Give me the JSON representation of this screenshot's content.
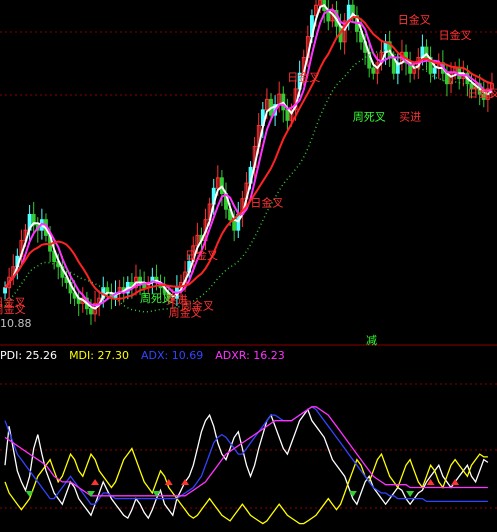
{
  "colors": {
    "background": "#000000",
    "up": "#54ffff",
    "down": "#33cc33",
    "bull": "#ff3333",
    "white_line": "#ffffff",
    "magenta_line": "#ff33ff",
    "red_line": "#ff2222",
    "dotted_line": "#33cc33",
    "grid": "#8b0000",
    "pdi": "#ffffff",
    "mdi": "#ffff00",
    "adx": "#3344ff",
    "adxr": "#ff33ff"
  },
  "price_label": "10.88",
  "badge": "减",
  "indicator_legend": [
    {
      "name": "PDI",
      "value": "25.26",
      "color": "#ffffff"
    },
    {
      "name": "MDI",
      "value": "27.30",
      "color": "#ffff00"
    },
    {
      "name": "ADX",
      "value": "10.69",
      "color": "#3344ff"
    },
    {
      "name": "ADXR",
      "value": "16.23",
      "color": "#ff33ff"
    }
  ],
  "signals": [
    {
      "text": "日金叉",
      "x_idx": 1,
      "y": 11.15,
      "color": "#ff3333"
    },
    {
      "text": "周金叉",
      "x_idx": 1,
      "y": 11.02,
      "color": "#ff3333"
    },
    {
      "text": "日金叉",
      "x_idx": 48,
      "y": 12.05,
      "color": "#ff3333"
    },
    {
      "text": "周金叉",
      "x_idx": 44,
      "y": 10.95,
      "color": "#ff3333"
    },
    {
      "text": "周死叉",
      "x_idx": 37,
      "y": 11.23,
      "color": "#33ff33"
    },
    {
      "text": "买进",
      "x_idx": 42,
      "y": 11.2,
      "color": "#ff3333"
    },
    {
      "text": "周金叉",
      "x_idx": 47,
      "y": 11.08,
      "color": "#ff3333"
    },
    {
      "text": "日金叉",
      "x_idx": 64,
      "y": 13.05,
      "color": "#ff3333"
    },
    {
      "text": "日金叉",
      "x_idx": 73,
      "y": 15.45,
      "color": "#ff3333"
    },
    {
      "text": "周死叉",
      "x_idx": 89,
      "y": 14.7,
      "color": "#33ff33"
    },
    {
      "text": "买进",
      "x_idx": 99,
      "y": 14.7,
      "color": "#ff3333"
    },
    {
      "text": "日金叉",
      "x_idx": 100,
      "y": 16.55,
      "color": "#ff3333"
    },
    {
      "text": "日金叉",
      "x_idx": 110,
      "y": 16.25,
      "color": "#ff3333"
    },
    {
      "text": "日金叉",
      "x_idx": 117,
      "y": 15.15,
      "color": "#ff3333"
    }
  ],
  "chart_data": [
    {
      "type": "candlestick",
      "title": "",
      "ylim": [
        10.5,
        17.0
      ],
      "series": [
        {
          "name": "close",
          "values": [
            11.5,
            11.7,
            11.9,
            12.1,
            12.4,
            12.6,
            12.9,
            12.7,
            12.6,
            12.8,
            12.5,
            12.2,
            12.0,
            11.9,
            11.7,
            11.6,
            11.4,
            11.3,
            11.2,
            11.3,
            11.1,
            11.0,
            11.2,
            11.3,
            11.5,
            11.4,
            11.3,
            11.4,
            11.5,
            11.4,
            11.6,
            11.5,
            11.7,
            11.6,
            11.5,
            11.6,
            11.7,
            11.6,
            11.5,
            11.4,
            11.3,
            11.3,
            11.5,
            11.6,
            11.8,
            12.0,
            12.3,
            12.5,
            12.4,
            12.8,
            13.1,
            13.4,
            13.6,
            13.3,
            13.0,
            12.8,
            12.6,
            12.9,
            13.2,
            13.5,
            13.8,
            14.2,
            14.6,
            14.9,
            15.1,
            14.8,
            15.0,
            15.2,
            14.9,
            14.7,
            14.9,
            15.3,
            15.6,
            15.9,
            16.3,
            16.7,
            16.9,
            17.0,
            16.8,
            16.6,
            16.8,
            16.5,
            16.2,
            16.6,
            16.9,
            16.7,
            16.4,
            16.2,
            16.0,
            15.7,
            15.6,
            15.8,
            16.0,
            16.2,
            15.9,
            15.6,
            15.8,
            16.0,
            15.8,
            15.6,
            15.7,
            15.9,
            16.1,
            15.9,
            15.6,
            15.7,
            15.8,
            15.6,
            15.4,
            15.6,
            15.7,
            15.5,
            15.6,
            15.4,
            15.3,
            15.4,
            15.2,
            15.1,
            15.3,
            15.4
          ]
        }
      ]
    },
    {
      "type": "line",
      "title": "",
      "ylim": [
        0,
        60
      ],
      "series": [
        {
          "name": "PDI",
          "values": [
            24,
            38,
            30,
            22,
            18,
            15,
            20,
            30,
            35,
            28,
            22,
            18,
            14,
            12,
            10,
            14,
            18,
            16,
            12,
            10,
            8,
            6,
            10,
            14,
            18,
            15,
            12,
            10,
            8,
            6,
            5,
            8,
            12,
            10,
            7,
            5,
            8,
            12,
            15,
            10,
            8,
            6,
            12,
            15,
            18,
            20,
            24,
            30,
            36,
            40,
            42,
            38,
            32,
            28,
            26,
            30,
            34,
            36,
            30,
            24,
            20,
            24,
            30,
            35,
            40,
            42,
            38,
            34,
            30,
            28,
            32,
            36,
            40,
            42,
            44,
            40,
            38,
            36,
            34,
            30,
            26,
            24,
            22,
            20,
            16,
            12,
            10,
            14,
            18,
            20,
            16,
            14,
            12,
            10,
            12,
            14,
            16,
            15,
            12,
            10,
            12,
            14,
            15,
            18,
            20,
            22,
            24,
            20,
            18,
            16,
            18,
            20,
            22,
            24,
            20,
            18,
            22,
            26,
            25
          ]
        },
        {
          "name": "MDI",
          "values": [
            18,
            14,
            12,
            10,
            8,
            10,
            12,
            16,
            20,
            22,
            24,
            26,
            22,
            18,
            20,
            24,
            28,
            26,
            22,
            20,
            24,
            28,
            26,
            22,
            20,
            18,
            16,
            18,
            22,
            26,
            28,
            30,
            26,
            22,
            18,
            16,
            14,
            18,
            22,
            20,
            16,
            14,
            12,
            10,
            8,
            6,
            5,
            6,
            8,
            10,
            12,
            10,
            8,
            6,
            5,
            4,
            6,
            8,
            10,
            8,
            6,
            5,
            4,
            3,
            4,
            6,
            8,
            10,
            8,
            6,
            5,
            4,
            3,
            3,
            4,
            5,
            6,
            8,
            10,
            12,
            10,
            8,
            10,
            14,
            18,
            22,
            26,
            24,
            20,
            18,
            22,
            26,
            28,
            24,
            20,
            18,
            16,
            20,
            24,
            26,
            22,
            18,
            16,
            20,
            24,
            22,
            18,
            16,
            20,
            24,
            26,
            24,
            22,
            20,
            24,
            26,
            28,
            27,
            27
          ]
        },
        {
          "name": "ADX",
          "values": [
            40,
            36,
            32,
            28,
            26,
            24,
            22,
            20,
            18,
            16,
            14,
            12,
            12,
            14,
            16,
            18,
            20,
            18,
            16,
            14,
            12,
            10,
            10,
            12,
            14,
            14,
            13,
            12,
            12,
            12,
            12,
            12,
            12,
            12,
            12,
            12,
            12,
            12,
            12,
            12,
            12,
            12,
            12,
            13,
            14,
            15,
            16,
            18,
            20,
            24,
            28,
            32,
            34,
            35,
            34,
            32,
            30,
            28,
            28,
            30,
            32,
            34,
            36,
            38,
            40,
            42,
            42,
            41,
            40,
            40,
            40,
            41,
            42,
            43,
            44,
            45,
            44,
            42,
            40,
            38,
            36,
            34,
            32,
            30,
            28,
            26,
            24,
            22,
            20,
            18,
            16,
            15,
            14,
            14,
            13,
            13,
            12,
            12,
            12,
            12,
            12,
            12,
            12,
            11,
            11,
            11,
            11,
            11,
            11,
            11,
            11,
            11,
            11,
            11,
            11,
            11,
            11,
            11,
            11
          ]
        },
        {
          "name": "ADXR",
          "values": [
            34,
            33,
            32,
            31,
            30,
            29,
            28,
            27,
            26,
            25,
            24,
            22,
            20,
            19,
            18,
            18,
            18,
            17,
            16,
            15,
            14,
            13,
            13,
            13,
            13,
            13,
            13,
            13,
            13,
            13,
            13,
            13,
            13,
            13,
            13,
            13,
            13,
            13,
            13,
            13,
            13,
            13,
            13,
            13,
            13,
            14,
            15,
            16,
            17,
            18,
            20,
            22,
            24,
            26,
            28,
            29,
            30,
            31,
            32,
            33,
            34,
            35,
            36,
            37,
            38,
            39,
            40,
            40,
            40,
            40,
            40,
            41,
            42,
            43,
            44,
            45,
            45,
            44,
            43,
            42,
            40,
            38,
            36,
            34,
            32,
            30,
            28,
            26,
            24,
            22,
            20,
            19,
            18,
            17,
            17,
            17,
            17,
            17,
            17,
            16,
            16,
            16,
            16,
            16,
            16,
            16,
            16,
            16,
            16,
            16,
            16,
            16,
            16,
            16,
            16,
            16,
            16,
            16,
            16
          ]
        }
      ]
    }
  ]
}
